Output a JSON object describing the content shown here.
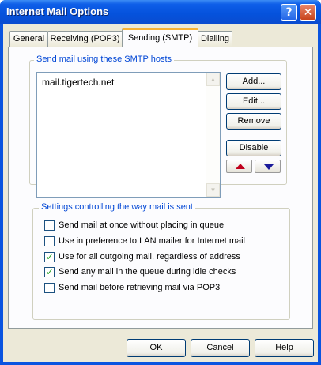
{
  "window": {
    "title": "Internet Mail Options",
    "help_glyph": "?",
    "close_glyph": "✕"
  },
  "tabs": [
    {
      "label": "General",
      "active": false
    },
    {
      "label": "Receiving (POP3)",
      "active": false
    },
    {
      "label": "Sending (SMTP)",
      "active": true
    },
    {
      "label": "Dialling",
      "active": false
    }
  ],
  "smtp_group": {
    "label": "Send mail using these SMTP hosts",
    "hosts": [
      "mail.tigertech.net"
    ],
    "buttons": {
      "add": "Add...",
      "edit": "Edit...",
      "remove": "Remove",
      "disable": "Disable"
    }
  },
  "settings_group": {
    "label": "Settings controlling the way mail is sent",
    "options": [
      {
        "label": "Send mail at once without placing in queue",
        "checked": false
      },
      {
        "label": "Use in preference to LAN mailer for Internet mail",
        "checked": false
      },
      {
        "label": "Use for all outgoing mail, regardless of address",
        "checked": true
      },
      {
        "label": "Send any mail in the queue during idle checks",
        "checked": true
      },
      {
        "label": "Send mail before retrieving mail via POP3",
        "checked": false
      }
    ]
  },
  "footer": {
    "ok": "OK",
    "cancel": "Cancel",
    "help": "Help"
  },
  "colors": {
    "titlebar": "#0552dc",
    "group_label": "#0046d5",
    "active_tab_accent": "#f8b234",
    "check": "#21a121"
  }
}
